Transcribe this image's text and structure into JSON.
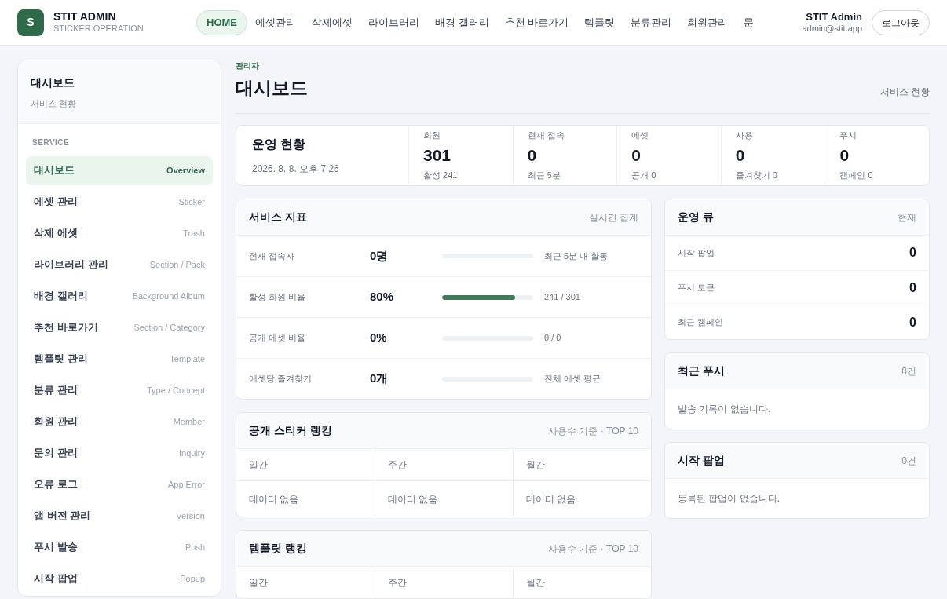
{
  "brand": {
    "logo": "S",
    "name": "STIT ADMIN",
    "subtitle": "STICKER OPERATION"
  },
  "nav": [
    {
      "label": "HOME",
      "selected": true
    },
    {
      "label": "에셋관리",
      "selected": false
    },
    {
      "label": "삭제에셋",
      "selected": false
    },
    {
      "label": "라이브러리",
      "selected": false
    },
    {
      "label": "배경 갤러리",
      "selected": false
    },
    {
      "label": "추천 바로가기",
      "selected": false
    },
    {
      "label": "템플릿",
      "selected": false
    },
    {
      "label": "분류관리",
      "selected": false
    },
    {
      "label": "회원관리",
      "selected": false
    },
    {
      "label": "문",
      "selected": false
    }
  ],
  "user": {
    "name": "STIT Admin",
    "email": "admin@stit.app",
    "logout": "로그아웃"
  },
  "sidebar": {
    "title": "대시보드",
    "subtitle": "서비스 현황",
    "section": "SERVICE",
    "items": [
      {
        "label": "대시보드",
        "hint": "Overview",
        "selected": true
      },
      {
        "label": "에셋 관리",
        "hint": "Sticker",
        "selected": false
      },
      {
        "label": "삭제 에셋",
        "hint": "Trash",
        "selected": false
      },
      {
        "label": "라이브러리 관리",
        "hint": "Section / Pack",
        "selected": false
      },
      {
        "label": "배경 갤러리",
        "hint": "Background Album",
        "selected": false
      },
      {
        "label": "추천 바로가기",
        "hint": "Section / Category",
        "selected": false
      },
      {
        "label": "템플릿 관리",
        "hint": "Template",
        "selected": false
      },
      {
        "label": "분류 관리",
        "hint": "Type / Concept",
        "selected": false
      },
      {
        "label": "회원 관리",
        "hint": "Member",
        "selected": false
      },
      {
        "label": "문의 관리",
        "hint": "Inquiry",
        "selected": false
      },
      {
        "label": "오류 로그",
        "hint": "App Error",
        "selected": false
      },
      {
        "label": "앱 버전 관리",
        "hint": "Version",
        "selected": false
      },
      {
        "label": "푸시 발송",
        "hint": "Push",
        "selected": false
      },
      {
        "label": "시작 팝업",
        "hint": "Popup",
        "selected": false
      }
    ]
  },
  "page": {
    "eyebrow": "관리자",
    "title": "대시보드",
    "aside": "서비스 현황"
  },
  "overview": {
    "title": "운영 현황",
    "date": "2026. 8. 8. 오후 7:26",
    "stats": [
      {
        "label": "회원",
        "value": "301",
        "sub": "활성 241"
      },
      {
        "label": "현재 접속",
        "value": "0",
        "sub": "최근 5분"
      },
      {
        "label": "에셋",
        "value": "0",
        "sub": "공개 0"
      },
      {
        "label": "사용",
        "value": "0",
        "sub": "즐겨찾기 0"
      },
      {
        "label": "푸시",
        "value": "0",
        "sub": "캠페인 0"
      }
    ]
  },
  "metrics": {
    "title": "서비스 지표",
    "aside": "실시간 집계",
    "rows": [
      {
        "label": "현재 접속자",
        "value": "0명",
        "level": 0,
        "note": "최근 5분 내 활동"
      },
      {
        "label": "활성 회원 비율",
        "value": "80%",
        "level": 0.8,
        "note": "241 / 301"
      },
      {
        "label": "공개 에셋 비율",
        "value": "0%",
        "level": 0,
        "note": "0 / 0"
      },
      {
        "label": "에셋당 즐겨찾기",
        "value": "0개",
        "level": 0,
        "note": "전체 에셋 평균"
      }
    ]
  },
  "rankings": [
    {
      "title": "공개 스티커 랭킹",
      "aside": "사용수 기준 · TOP 10",
      "columns": [
        "일간",
        "주간",
        "월간"
      ],
      "cells": [
        "데이터 없음",
        "데이터 없음",
        "데이터 없음"
      ]
    },
    {
      "title": "템플릿 랭킹",
      "aside": "사용수 기준 · TOP 10",
      "columns": [
        "일간",
        "주간",
        "월간"
      ]
    }
  ],
  "queue": {
    "title": "운영 큐",
    "aside": "현재",
    "rows": [
      {
        "label": "시작 팝업",
        "value": "0"
      },
      {
        "label": "푸시 토큰",
        "value": "0"
      },
      {
        "label": "최근 캠페인",
        "value": "0"
      }
    ]
  },
  "lists": [
    {
      "title": "최근 푸시",
      "aside": "0건",
      "empty": "발송 기록이 없습니다."
    },
    {
      "title": "시작 팝업",
      "aside": "0건",
      "empty": "등록된 팝업이 없습니다."
    }
  ]
}
